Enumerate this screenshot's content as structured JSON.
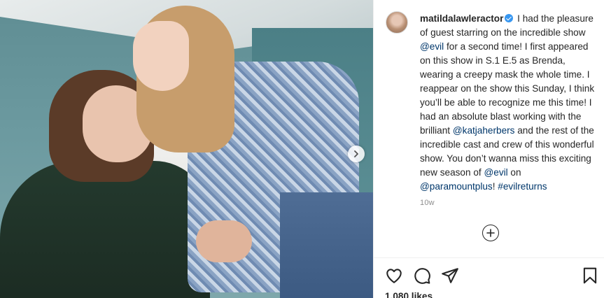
{
  "post": {
    "username": "matildalawleractor",
    "caption_parts": [
      {
        "type": "text",
        "value": " I had the pleasure of guest starring on the incredible show "
      },
      {
        "type": "mention",
        "value": "@evil"
      },
      {
        "type": "text",
        "value": " for a second time! I first appeared on this show in S.1 E.5 as Brenda, wearing a creepy mask the whole time. I reappear on the show this Sunday, I think you’ll be able to recognize me this time! I had an absolute blast working with the brilliant "
      },
      {
        "type": "mention",
        "value": "@katjaherbers"
      },
      {
        "type": "text",
        "value": " and the rest of the incredible cast and crew of this wonderful show. You don’t wanna miss this exciting new season of "
      },
      {
        "type": "mention",
        "value": "@evil"
      },
      {
        "type": "text",
        "value": " on "
      },
      {
        "type": "mention",
        "value": "@paramountplus"
      },
      {
        "type": "text",
        "value": "! "
      },
      {
        "type": "mention",
        "value": "#evilreturns"
      }
    ],
    "timestamp": "10w",
    "likes": "1,080 likes"
  },
  "icons": {
    "verified": "verified-badge-icon",
    "next": "chevron-right-icon",
    "load_more": "plus-circle-icon",
    "like": "heart-icon",
    "comment": "comment-bubble-icon",
    "share": "paper-plane-icon",
    "save": "bookmark-icon"
  },
  "colors": {
    "verified": "#3897f0",
    "mention": "#00376b",
    "muted": "#8e8e8e",
    "text": "#262626"
  }
}
